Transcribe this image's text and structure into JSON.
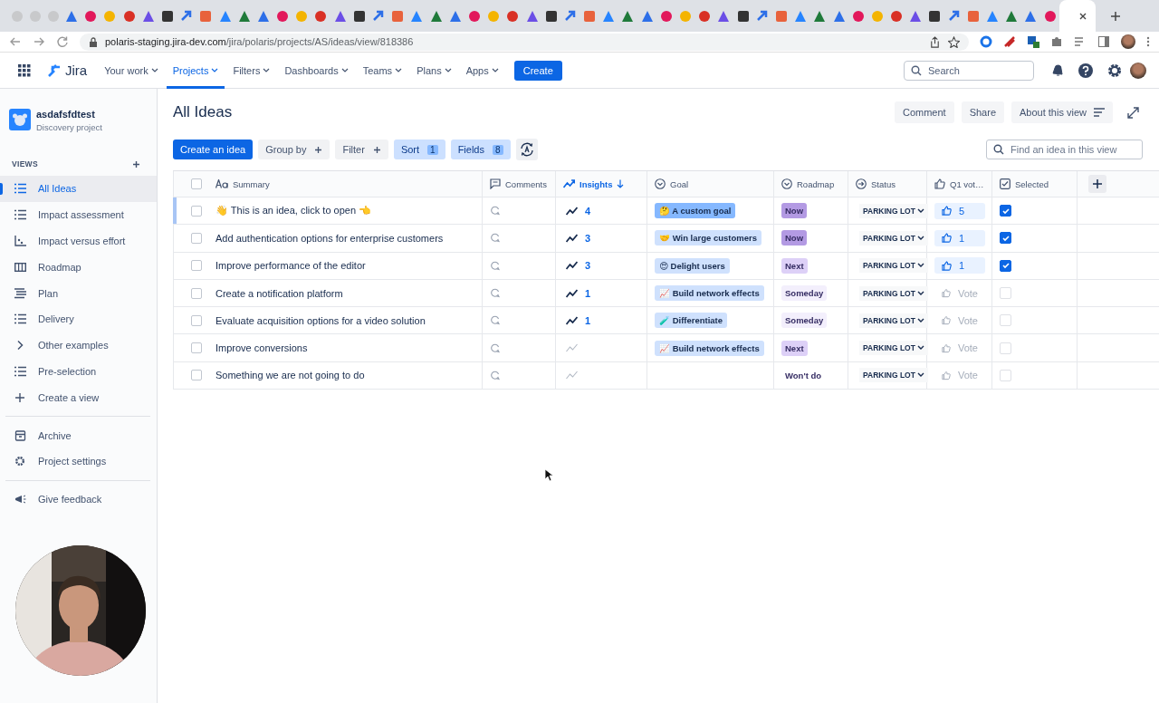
{
  "browser": {
    "url_host": "polaris-staging.jira-dev.com",
    "url_path": "/jira/polaris/projects/AS/ideas/view/818386"
  },
  "nav": {
    "product": "Jira",
    "items": [
      {
        "label": "Your work",
        "selected": false
      },
      {
        "label": "Projects",
        "selected": true
      },
      {
        "label": "Filters",
        "selected": false
      },
      {
        "label": "Dashboards",
        "selected": false
      },
      {
        "label": "Teams",
        "selected": false
      },
      {
        "label": "Plans",
        "selected": false
      },
      {
        "label": "Apps",
        "selected": false
      }
    ],
    "create": "Create",
    "search": {
      "placeholder": "Search"
    }
  },
  "sidebar": {
    "project": {
      "name": "asdafsfdtest",
      "type": "Discovery project"
    },
    "views_heading": "VIEWS",
    "views": [
      {
        "label": "All Ideas",
        "kind": "list",
        "selected": true
      },
      {
        "label": "Impact assessment",
        "kind": "list",
        "selected": false
      },
      {
        "label": "Impact versus effort",
        "kind": "matrix",
        "selected": false
      },
      {
        "label": "Roadmap",
        "kind": "board",
        "selected": false
      },
      {
        "label": "Plan",
        "kind": "plan",
        "selected": false
      },
      {
        "label": "Delivery",
        "kind": "list",
        "selected": false
      },
      {
        "label": "Other examples",
        "kind": "folder",
        "expanded": false,
        "selected": false
      },
      {
        "label": "Pre-selection",
        "kind": "list",
        "selected": false
      }
    ],
    "create_view": "Create a view",
    "archive": "Archive",
    "settings": "Project settings",
    "feedback": "Give feedback"
  },
  "page": {
    "title": "All Ideas",
    "actions": [
      "Comment",
      "Share",
      "About this view"
    ],
    "toolbar": [
      {
        "label": "Create an idea",
        "kind": "primary"
      },
      {
        "label": "Group by",
        "kind": "add"
      },
      {
        "label": "Filter",
        "kind": "add"
      },
      {
        "label": "Sort",
        "kind": "count",
        "count": "1"
      },
      {
        "label": "Fields",
        "kind": "count",
        "count": "8"
      }
    ],
    "find": {
      "placeholder": "Find an idea in this view"
    }
  },
  "table": {
    "all_ticked": false,
    "columns": [
      {
        "label": "Summary",
        "kind": "text"
      },
      {
        "label": "Comments",
        "kind": "comments"
      },
      {
        "label": "Insights",
        "kind": "insights",
        "sorted": true
      },
      {
        "label": "Goal",
        "kind": "goal"
      },
      {
        "label": "Roadmap",
        "kind": "roadmap"
      },
      {
        "label": "Status",
        "kind": "status"
      },
      {
        "label": "Q1 vot…",
        "kind": "votes"
      },
      {
        "label": "Selected",
        "kind": "check"
      }
    ],
    "rows": [
      {
        "summary": "👋 This is an idea, click to open 👈",
        "selected": true,
        "ticked": false,
        "insights": "4",
        "goal": {
          "label": "🤔 A custom goal",
          "selected": true
        },
        "roadmap": {
          "label": "Now",
          "color": "#b39ae3"
        },
        "status": "PARKING LOT",
        "votes": {
          "label": "5",
          "voted": true
        },
        "checked": true
      },
      {
        "summary": "Add authentication options for enterprise customers",
        "selected": false,
        "ticked": false,
        "insights": "3",
        "goal": {
          "label": "🤝 Win large customers",
          "selected": false
        },
        "roadmap": {
          "label": "Now",
          "color": "#b39ae3"
        },
        "status": "PARKING LOT",
        "votes": {
          "label": "1",
          "voted": true
        },
        "checked": true
      },
      {
        "summary": "Improve performance of the editor",
        "selected": false,
        "ticked": false,
        "insights": "3",
        "goal": {
          "label": "😍 Delight users",
          "selected": false
        },
        "roadmap": {
          "label": "Next",
          "color": "#ddd0f7"
        },
        "status": "PARKING LOT",
        "votes": {
          "label": "1",
          "voted": true
        },
        "checked": true
      },
      {
        "summary": "Create a notification platform",
        "selected": false,
        "ticked": false,
        "insights": "1",
        "goal": {
          "label": "📈 Build network effects",
          "selected": false
        },
        "roadmap": {
          "label": "Someday",
          "color": "#f3effc"
        },
        "status": "PARKING LOT",
        "votes": {
          "label": "Vote",
          "voted": false
        },
        "checked": false
      },
      {
        "summary": "Evaluate acquisition options for a video solution",
        "selected": false,
        "ticked": false,
        "insights": "1",
        "goal": {
          "label": "🧪 Differentiate",
          "selected": false
        },
        "roadmap": {
          "label": "Someday",
          "color": "#f3effc"
        },
        "status": "PARKING LOT",
        "votes": {
          "label": "Vote",
          "voted": false
        },
        "checked": false
      },
      {
        "summary": "Improve conversions",
        "selected": false,
        "ticked": false,
        "goal": {
          "label": "📈 Build network effects",
          "selected": false
        },
        "roadmap": {
          "label": "Next",
          "color": "#ddd0f7"
        },
        "status": "PARKING LOT",
        "votes": {
          "label": "Vote",
          "voted": false
        },
        "checked": false
      },
      {
        "summary": "Something we are not going to do",
        "selected": false,
        "ticked": false,
        "roadmap": {
          "label": "Won't do",
          "color": "#ffffff"
        },
        "status": "PARKING LOT",
        "votes": {
          "label": "Vote",
          "voted": false
        },
        "checked": false
      }
    ]
  }
}
